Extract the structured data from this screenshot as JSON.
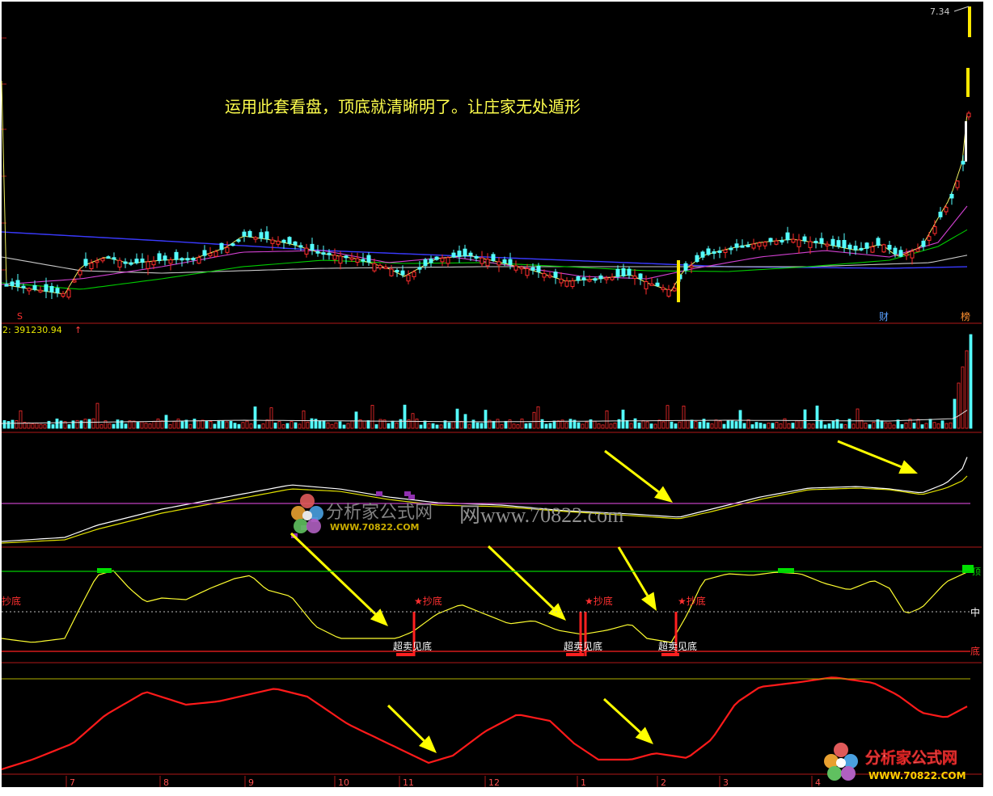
{
  "header": {
    "price_label": "7.34",
    "headline": "运用此套看盘，顶底就清晰明了。让庄家无处遁形",
    "volume_label": "2: 391230.94"
  },
  "markers": {
    "s_mark": "S",
    "cai_badge": "财",
    "bang_badge": "榜"
  },
  "oscillator": {
    "label_chaodi": "抄底",
    "label_mid": "中",
    "label_top": "顶",
    "label_bottom": "底",
    "signals": [
      {
        "buy": "★抄底",
        "oversold": "超卖见底"
      },
      {
        "buy": "★抄底",
        "oversold": "超卖见底"
      },
      {
        "buy": "★抄底",
        "oversold": "超卖见底"
      }
    ]
  },
  "watermark": {
    "center_brand": "分析家公式网",
    "center_url_cn": "网www.70822.com",
    "center_url": "WWW.70822.COM",
    "corner_brand": "分析家公式网",
    "corner_url": "WWW.70822.COM"
  },
  "colors": {
    "background": "#000000",
    "bull_candle": "#ff2d2d",
    "bear_candle": "#54ffff",
    "divider": "#b01818",
    "headline": "#ffff4d",
    "arrow": "#ffff00",
    "green_line": "#00cc00",
    "magenta_line": "#d040d0",
    "oscillator_line": "#ffff30",
    "lower_curve": "#ff1a1a"
  },
  "chart_data": {
    "type": "candlestick",
    "panels": [
      "price",
      "volume",
      "trend",
      "oscillator",
      "cycle"
    ],
    "x_axis_months": [
      "7",
      "8",
      "9",
      "10",
      "11",
      "12",
      "1",
      "2",
      "3",
      "4"
    ],
    "price_last": 7.34,
    "volume_value": 391230.94,
    "signals_count": 3
  }
}
